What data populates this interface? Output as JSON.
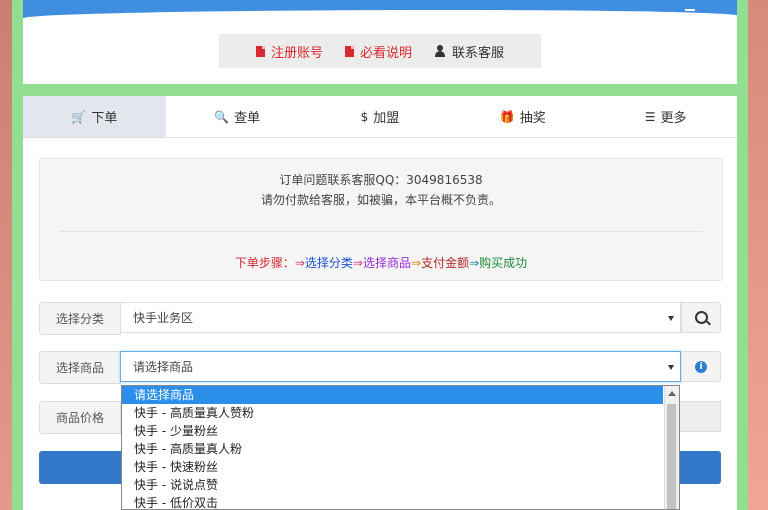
{
  "top_links": [
    {
      "label": "注册账号",
      "icon": "document-icon",
      "color": "#d9282f"
    },
    {
      "label": "必看说明",
      "icon": "document-icon",
      "color": "#d9282f"
    },
    {
      "label": "联系客服",
      "icon": "user-icon",
      "color": "#333333"
    }
  ],
  "tabs": [
    {
      "label": "下单",
      "icon": "cart-icon",
      "glyph": "🛒",
      "active": true
    },
    {
      "label": "查单",
      "icon": "search-icon",
      "glyph": "🔍",
      "active": false
    },
    {
      "label": "加盟",
      "icon": "dollar-icon",
      "glyph": "$",
      "active": false
    },
    {
      "label": "抽奖",
      "icon": "gift-icon",
      "glyph": "🎁",
      "active": false
    },
    {
      "label": "更多",
      "icon": "list-icon",
      "glyph": "☰",
      "active": false
    }
  ],
  "notice": {
    "line1": "订单问题联系客服QQ：3049816538",
    "line2": "请勿付款给客服，如被骗，本平台概不负责。",
    "steps": [
      {
        "text": "下单步骤：",
        "color": "#d9282f"
      },
      {
        "text": "⇒",
        "color": "#e0308a"
      },
      {
        "text": "选择分类",
        "color": "#1f4fd8"
      },
      {
        "text": "⇒",
        "color": "#e0308a"
      },
      {
        "text": "选择商品",
        "color": "#9a2bd6"
      },
      {
        "text": "⇒",
        "color": "#e37b1a"
      },
      {
        "text": "支付金额",
        "color": "#b2262a"
      },
      {
        "text": "⇒",
        "color": "#1a8b9b"
      },
      {
        "text": "购买成功",
        "color": "#1a8a3a"
      }
    ]
  },
  "form": {
    "category_label": "选择分类",
    "category_value": "快手业务区",
    "product_label": "选择商品",
    "product_value": "请选择商品",
    "price_label": "商品价格",
    "price_value": ""
  },
  "dropdown_options": [
    "请选择商品",
    "快手 - 高质量真人赞粉",
    "快手 - 少量粉丝",
    "快手 - 高质量真人粉",
    "快手 - 快速粉丝",
    "快手 - 说说点赞",
    "快手 - 低价双击"
  ],
  "colors": {
    "accent": "#3478c9",
    "highlight": "#2b8fea",
    "frame": "#92de93"
  }
}
